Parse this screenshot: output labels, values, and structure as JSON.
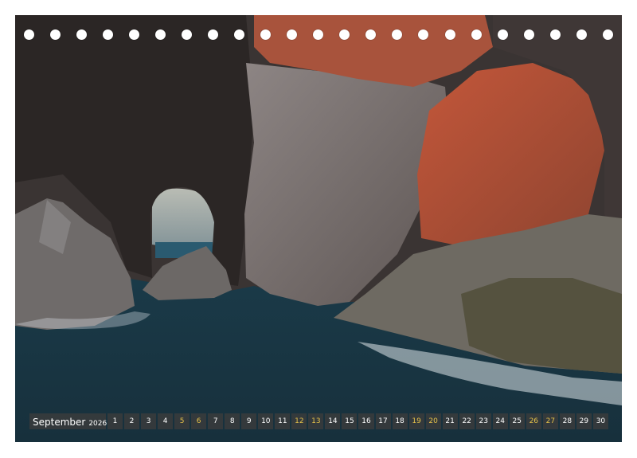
{
  "calendar": {
    "month": "September",
    "year": "2026",
    "days": [
      {
        "n": "1",
        "weekend": false
      },
      {
        "n": "2",
        "weekend": false
      },
      {
        "n": "3",
        "weekend": false
      },
      {
        "n": "4",
        "weekend": false
      },
      {
        "n": "5",
        "weekend": true
      },
      {
        "n": "6",
        "weekend": true
      },
      {
        "n": "7",
        "weekend": false
      },
      {
        "n": "8",
        "weekend": false
      },
      {
        "n": "9",
        "weekend": false
      },
      {
        "n": "10",
        "weekend": false
      },
      {
        "n": "11",
        "weekend": false
      },
      {
        "n": "12",
        "weekend": true
      },
      {
        "n": "13",
        "weekend": true
      },
      {
        "n": "14",
        "weekend": false
      },
      {
        "n": "15",
        "weekend": false
      },
      {
        "n": "16",
        "weekend": false
      },
      {
        "n": "17",
        "weekend": false
      },
      {
        "n": "18",
        "weekend": false
      },
      {
        "n": "19",
        "weekend": true
      },
      {
        "n": "20",
        "weekend": true
      },
      {
        "n": "21",
        "weekend": false
      },
      {
        "n": "22",
        "weekend": false
      },
      {
        "n": "23",
        "weekend": false
      },
      {
        "n": "24",
        "weekend": false
      },
      {
        "n": "25",
        "weekend": false
      },
      {
        "n": "26",
        "weekend": true
      },
      {
        "n": "27",
        "weekend": true
      },
      {
        "n": "28",
        "weekend": false
      },
      {
        "n": "29",
        "weekend": false
      },
      {
        "n": "30",
        "weekend": false
      }
    ]
  },
  "colors": {
    "weekend_text": "#e6c24a",
    "weekday_text": "#ffffff",
    "strip_background": "#3c3c3c"
  }
}
